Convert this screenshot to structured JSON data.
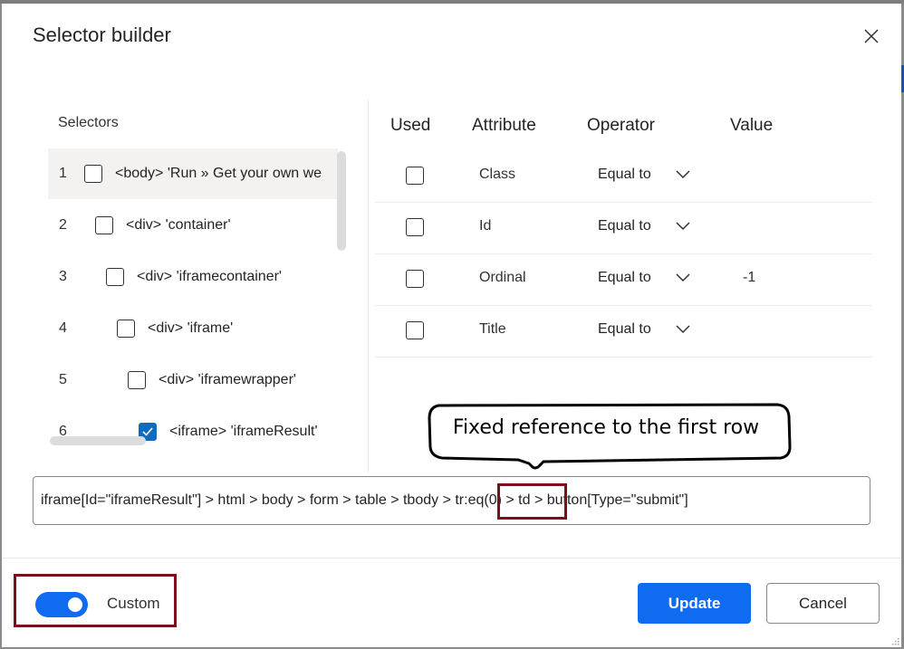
{
  "dialog": {
    "title": "Selector builder",
    "close_icon": "close-icon"
  },
  "selectors": {
    "label": "Selectors",
    "items": [
      {
        "index": "1",
        "text": "<body> 'Run » Get your own we",
        "checked": false,
        "selected": true
      },
      {
        "index": "2",
        "text": "<div> 'container'",
        "checked": false,
        "selected": false
      },
      {
        "index": "3",
        "text": "<div> 'iframecontainer'",
        "checked": false,
        "selected": false
      },
      {
        "index": "4",
        "text": "<div> 'iframe'",
        "checked": false,
        "selected": false
      },
      {
        "index": "5",
        "text": "<div> 'iframewrapper'",
        "checked": false,
        "selected": false
      },
      {
        "index": "6",
        "text": "<iframe> 'iframeResult'",
        "checked": true,
        "selected": false
      }
    ]
  },
  "attributes": {
    "headers": {
      "used": "Used",
      "attribute": "Attribute",
      "operator": "Operator",
      "value": "Value"
    },
    "rows": [
      {
        "used": false,
        "attribute": "Class",
        "operator": "Equal to",
        "value": ""
      },
      {
        "used": false,
        "attribute": "Id",
        "operator": "Equal to",
        "value": ""
      },
      {
        "used": false,
        "attribute": "Ordinal",
        "operator": "Equal to",
        "value": "-1"
      },
      {
        "used": false,
        "attribute": "Title",
        "operator": "Equal to",
        "value": ""
      }
    ]
  },
  "callout": {
    "text": "Fixed reference to the first row"
  },
  "selector_field": {
    "value": "iframe[Id=\"iframeResult\"] > html > body > form > table > tbody > tr:eq(0) > td > button[Type=\"submit\"]",
    "highlighted_part": "tr:eq(0)"
  },
  "footer": {
    "toggle_label": "Custom",
    "toggle_on": true,
    "update_label": "Update",
    "cancel_label": "Cancel"
  },
  "colors": {
    "accent": "#0f6cf0",
    "highlight_border": "#7b0f1d"
  }
}
